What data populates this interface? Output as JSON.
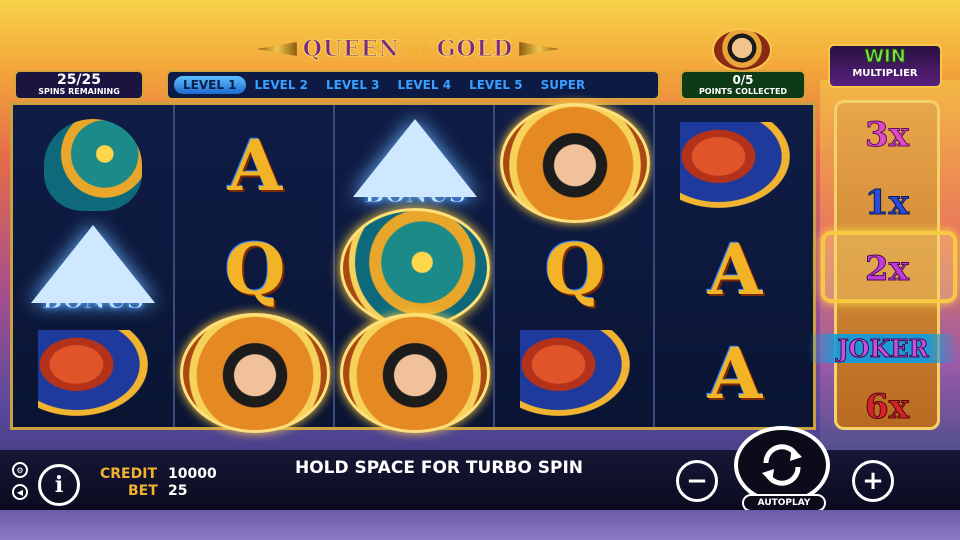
{
  "title": {
    "queen": "QUEEN",
    "of": "of",
    "gold": "GOLD"
  },
  "spins": {
    "count": "25/25",
    "label": "SPINS REMAINING"
  },
  "levels": [
    {
      "label": "LEVEL 1",
      "active": true
    },
    {
      "label": "LEVEL 2",
      "active": false
    },
    {
      "label": "LEVEL 3",
      "active": false
    },
    {
      "label": "LEVEL 4",
      "active": false
    },
    {
      "label": "LEVEL 5",
      "active": false
    },
    {
      "label": "SUPER",
      "active": false
    }
  ],
  "points": {
    "count": "0/5",
    "label": "POINTS COLLECTED"
  },
  "win_multiplier": {
    "line1": "WIN",
    "line2": "MULTIPLIER"
  },
  "multipliers": [
    "3x",
    "1x",
    "2x",
    "JOKER",
    "6x"
  ],
  "reels": [
    [
      "horus",
      "bonus",
      "anubis"
    ],
    [
      "A",
      "Q",
      "queen"
    ],
    [
      "bonus",
      "horus",
      "queen"
    ],
    [
      "queen",
      "Q",
      "anubis"
    ],
    [
      "anubis",
      "A",
      "A"
    ]
  ],
  "bonus_label": "BONUS",
  "bottom": {
    "credit_label": "CREDIT",
    "credit_value": "10000",
    "bet_label": "BET",
    "bet_value": "25",
    "turbo_text": "HOLD SPACE FOR TURBO SPIN",
    "autoplay_label": "AUTOPLAY",
    "minus": "−",
    "plus": "+",
    "info": "i"
  }
}
